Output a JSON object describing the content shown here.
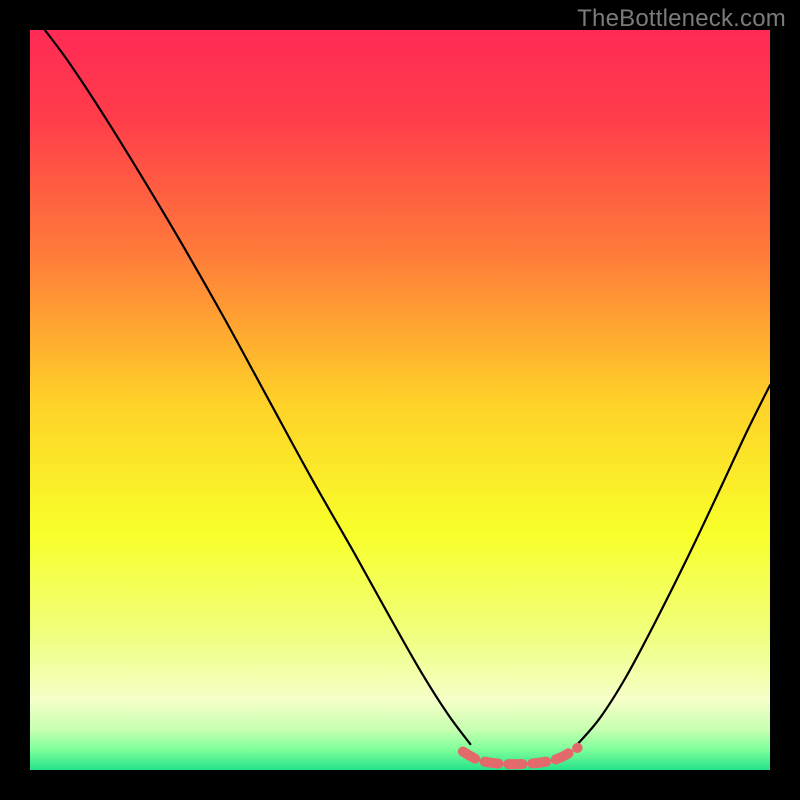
{
  "watermark": "TheBottleneck.com",
  "chart_data": {
    "type": "line",
    "title": "",
    "xlabel": "",
    "ylabel": "",
    "xlim": [
      0,
      100
    ],
    "ylim": [
      0,
      100
    ],
    "background_gradient": {
      "stops": [
        {
          "offset": 0.0,
          "color": "#ff2a55"
        },
        {
          "offset": 0.12,
          "color": "#ff3d4a"
        },
        {
          "offset": 0.3,
          "color": "#ff7a3a"
        },
        {
          "offset": 0.5,
          "color": "#ffd028"
        },
        {
          "offset": 0.68,
          "color": "#f8ff2a"
        },
        {
          "offset": 0.82,
          "color": "#f0ff80"
        },
        {
          "offset": 0.905,
          "color": "#f6ffc8"
        },
        {
          "offset": 0.945,
          "color": "#c7ffb0"
        },
        {
          "offset": 0.972,
          "color": "#7fff9a"
        },
        {
          "offset": 1.0,
          "color": "#26e28a"
        }
      ]
    },
    "series": [
      {
        "name": "curve-left",
        "stroke": "#000000",
        "stroke_width": 2.2,
        "points": [
          {
            "x": 2.0,
            "y": 100.0
          },
          {
            "x": 5.0,
            "y": 96.0
          },
          {
            "x": 9.0,
            "y": 90.0
          },
          {
            "x": 14.0,
            "y": 82.0
          },
          {
            "x": 20.0,
            "y": 72.0
          },
          {
            "x": 26.0,
            "y": 61.5
          },
          {
            "x": 32.0,
            "y": 50.5
          },
          {
            "x": 38.0,
            "y": 39.5
          },
          {
            "x": 44.0,
            "y": 29.0
          },
          {
            "x": 49.0,
            "y": 20.0
          },
          {
            "x": 53.0,
            "y": 13.0
          },
          {
            "x": 56.5,
            "y": 7.5
          },
          {
            "x": 59.5,
            "y": 3.5
          }
        ]
      },
      {
        "name": "curve-right",
        "stroke": "#000000",
        "stroke_width": 2.2,
        "points": [
          {
            "x": 74.0,
            "y": 3.5
          },
          {
            "x": 77.0,
            "y": 7.0
          },
          {
            "x": 80.5,
            "y": 12.5
          },
          {
            "x": 84.5,
            "y": 20.0
          },
          {
            "x": 89.0,
            "y": 29.0
          },
          {
            "x": 93.5,
            "y": 38.5
          },
          {
            "x": 97.0,
            "y": 46.0
          },
          {
            "x": 100.0,
            "y": 52.0
          }
        ]
      },
      {
        "name": "floor-band",
        "stroke": "#e26a6a",
        "stroke_width": 10,
        "dashed": true,
        "points": [
          {
            "x": 58.5,
            "y": 2.5
          },
          {
            "x": 60.5,
            "y": 1.4
          },
          {
            "x": 63.0,
            "y": 0.9
          },
          {
            "x": 66.0,
            "y": 0.8
          },
          {
            "x": 69.0,
            "y": 1.0
          },
          {
            "x": 71.5,
            "y": 1.6
          },
          {
            "x": 74.0,
            "y": 3.0
          }
        ]
      }
    ]
  }
}
